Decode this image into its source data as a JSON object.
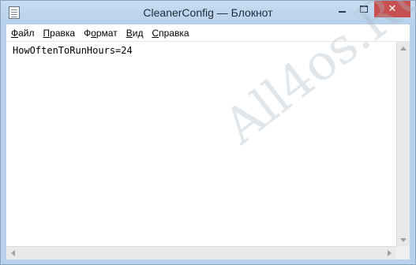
{
  "window": {
    "title": "CleanerConfig — Блокнот",
    "controls": {
      "minimize_icon": "minimize-icon",
      "maximize_icon": "maximize-icon",
      "close_icon": "close-icon",
      "close_glyph": "✕"
    }
  },
  "menu": {
    "file": {
      "accel": "Ф",
      "rest": "айл"
    },
    "edit": {
      "accel": "П",
      "rest": "равка"
    },
    "format": {
      "accel": "о",
      "pre": "Ф",
      "rest": "рмат"
    },
    "view": {
      "accel": "В",
      "rest": "ид"
    },
    "help": {
      "accel": "С",
      "rest": "правка"
    }
  },
  "document": {
    "text": "HowOftenToRunHours=24"
  },
  "watermark": "All4os.RU",
  "colors": {
    "frame": "#b9d1ea",
    "close_button": "#c75050"
  }
}
